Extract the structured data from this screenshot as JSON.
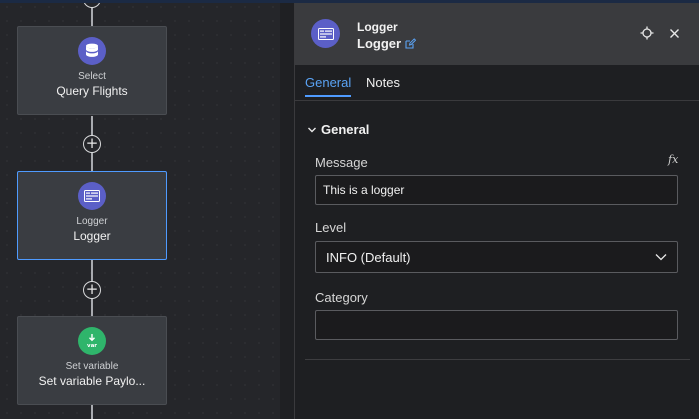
{
  "canvas": {
    "nodes": [
      {
        "type": "Select",
        "title": "Query Flights",
        "icon": "database-icon",
        "color": "#5b5fc7"
      },
      {
        "type": "Logger",
        "title": "Logger",
        "icon": "logger-icon",
        "color": "#5b5fc7"
      },
      {
        "type": "Set variable",
        "title": "Set variable Paylo...",
        "icon": "set-variable-icon",
        "color": "#2fb56b"
      }
    ],
    "add_step_symbol": "+"
  },
  "panel": {
    "header": {
      "type": "Logger",
      "title": "Logger"
    },
    "tabs": [
      {
        "label": "General",
        "active": true
      },
      {
        "label": "Notes",
        "active": false
      }
    ],
    "section_title": "General",
    "fields": {
      "message": {
        "label": "Message",
        "value": "This is a logger",
        "fx": "fx"
      },
      "level": {
        "label": "Level",
        "value": "INFO (Default)"
      },
      "category": {
        "label": "Category",
        "value": ""
      }
    }
  },
  "colors": {
    "accent": "#4f9bff",
    "node_bg": "#3a3d42",
    "logger_icon": "#5b5fc7",
    "set_variable_icon": "#2fb56b"
  }
}
